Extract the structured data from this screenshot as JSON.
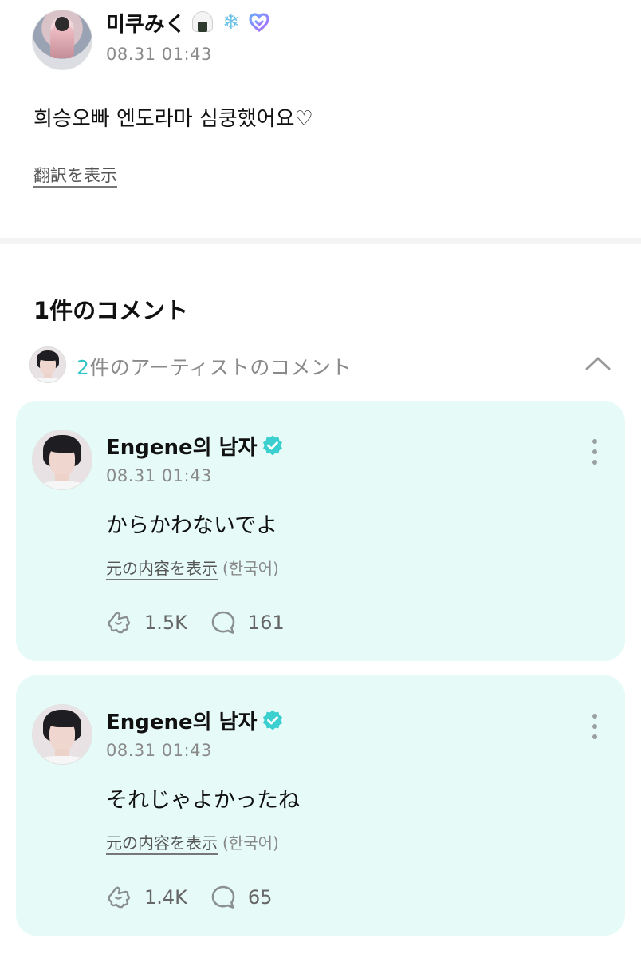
{
  "post": {
    "author": "미쿠みく",
    "emoji_icons": [
      "rice-ball-icon",
      "snowflake-icon",
      "heart-logo-icon"
    ],
    "time": "08.31 01:43",
    "text": "희승오빠 엔도라마 심쿵했어요♡",
    "translate_label": "翻訳を表示"
  },
  "comments_section": {
    "title": "1件のコメント",
    "artist_row": {
      "count": "2",
      "label": "件のアーティストのコメント",
      "toggle_icon": "chevron-up-icon"
    }
  },
  "comments": [
    {
      "author": "Engene의 남자",
      "verified": true,
      "time": "08.31 01:43",
      "text": "からかわないでよ",
      "original_label": "元の内容を表示",
      "language": "(한국어)",
      "likes": "1.5K",
      "replies": "161"
    },
    {
      "author": "Engene의 남자",
      "verified": true,
      "time": "08.31 01:43",
      "text": "それじゃよかったね",
      "original_label": "元の内容を表示",
      "language": "(한국어)",
      "likes": "1.4K",
      "replies": "65"
    }
  ],
  "colors": {
    "accent": "#33c6c4",
    "card_bg": "#e6fbf7",
    "muted_text": "#8a8a8a"
  }
}
